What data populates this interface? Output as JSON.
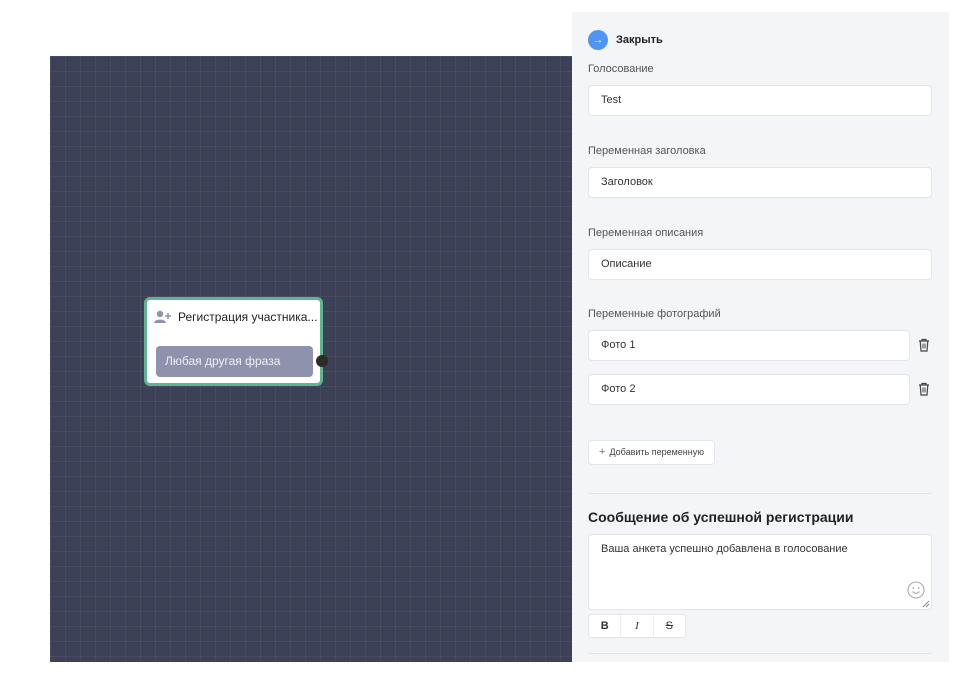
{
  "canvas": {
    "node": {
      "title": "Регистрация участника...",
      "phrase": "Любая другая фраза",
      "icon": "user-add-icon"
    }
  },
  "panel": {
    "close_label": "Закрыть",
    "close_icon": "arrow-right-icon",
    "voting": {
      "label": "Голосование",
      "value": "Test"
    },
    "header_var": {
      "label": "Переменная заголовка",
      "value": "Заголовок"
    },
    "description_var": {
      "label": "Переменная описания",
      "value": "Описание"
    },
    "photo_vars": {
      "label": "Переменные фотографий",
      "items": [
        "Фото 1",
        "Фото 2"
      ]
    },
    "add_variable": {
      "plus": "+",
      "label": "Добавить переменную"
    },
    "success_message": {
      "title": "Сообщение об успешной регистрации",
      "text": "Ваша анкета успешно добавлена в голосование"
    },
    "format": {
      "bold": "B",
      "italic": "I",
      "strike": "S"
    }
  },
  "colors": {
    "canvas_bg": "#3d4157",
    "node_border": "#5fb491",
    "phrase_bg": "#8e92ac",
    "accent": "#4f96f4"
  }
}
